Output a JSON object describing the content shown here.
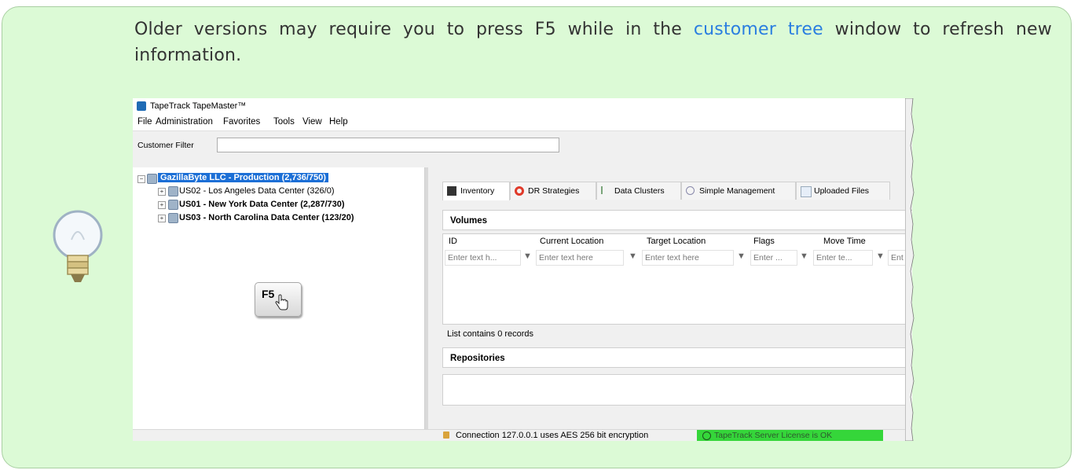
{
  "tip": {
    "before_link": "Older versions may require you to press F5 while in the ",
    "link_text": "customer tree",
    "after_link": " window to refresh new information.",
    "icon": "lightbulb-icon"
  },
  "app": {
    "title": "TapeTrack TapeMaster™",
    "menu": [
      "File",
      "Administration",
      "Favorites",
      "Tools",
      "View",
      "Help"
    ],
    "filter_label": "Customer Filter",
    "filter_value": ""
  },
  "tree": {
    "root": "GazillaByte LLC - Production (2,736/750)",
    "children": [
      "US02 - Los Angeles Data Center (326/0)",
      "US01 - New York Data Center (2,287/730)",
      "US03 - North Carolina Data Center (123/20)"
    ],
    "key_label": "F5"
  },
  "tabs": [
    "Inventory",
    "DR Strategies",
    "Data Clusters",
    "Simple Management",
    "Uploaded Files"
  ],
  "volumes": {
    "title": "Volumes",
    "columns": [
      "ID",
      "Current Location",
      "Target Location",
      "Flags",
      "Move Time"
    ],
    "filters": [
      "Enter text h...",
      "Enter text here",
      "Enter text here",
      "Enter ...",
      "Enter te...",
      "Ent"
    ],
    "record_count": "List contains 0 records"
  },
  "repositories": {
    "title": "Repositories"
  },
  "status": {
    "connection": "Connection 127.0.0.1 uses AES 256 bit encryption",
    "license": "TapeTrack Server License is OK"
  },
  "colors": {
    "tip_bg": "#dcfad6",
    "link": "#2a7ee0",
    "selection": "#1c6fd6",
    "license_ok": "#35d63a"
  }
}
